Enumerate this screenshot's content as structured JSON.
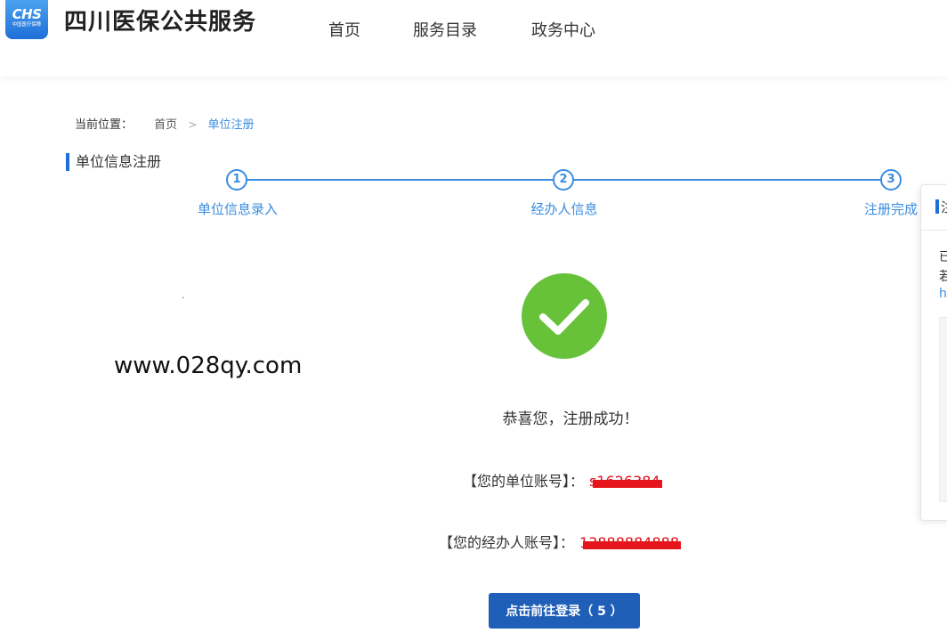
{
  "header": {
    "logo_mark": "CHS",
    "logo_sub": "中国医疗保障",
    "site_title": "四川医保公共服务",
    "nav": [
      "首页",
      "服务目录",
      "政务中心"
    ]
  },
  "breadcrumb": {
    "label": "当前位置：",
    "home": "首页",
    "separator": ">",
    "current": "单位注册"
  },
  "section_title": "单位信息注册",
  "steps": [
    {
      "number": "1",
      "label": "单位信息录入"
    },
    {
      "number": "2",
      "label": "经办人信息"
    },
    {
      "number": "3",
      "label": "注册完成"
    }
  ],
  "watermark": {
    "dot": ".",
    "text": "www.028qy.com"
  },
  "result": {
    "message": "恭喜您，注册成功！",
    "unit_account_label": "【您的单位账号】：",
    "unit_account_value": "s1626384",
    "agent_account_label": "【您的经办人账号】：",
    "agent_account_value": "13888884888"
  },
  "login_button": "点击前往登录（ 5 ）",
  "side_panel": {
    "title": "注",
    "line1": "已",
    "line2": "若",
    "link": "h"
  },
  "colors": {
    "primary": "#1f5fb8",
    "accent_blue": "#3b8de0",
    "success_green": "#67c23a",
    "redact_red": "#e6141c"
  }
}
